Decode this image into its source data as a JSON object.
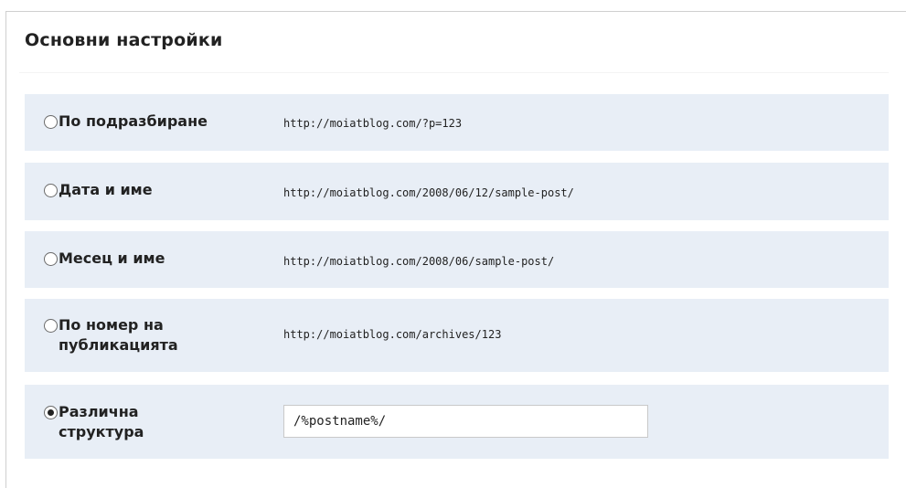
{
  "section": {
    "title": "Основни настройки"
  },
  "options": [
    {
      "label": "По подразбиране",
      "example": "http://moiatblog.com/?p=123",
      "selected": false
    },
    {
      "label": "Дата и име",
      "example": "http://moiatblog.com/2008/06/12/sample-post/",
      "selected": false
    },
    {
      "label": "Месец и име",
      "example": "http://moiatblog.com/2008/06/sample-post/",
      "selected": false
    },
    {
      "label": "По номер на публикацията",
      "example": "http://moiatblog.com/archives/123",
      "selected": false
    },
    {
      "label": "Различна структура",
      "value": "/%postname%/",
      "selected": true
    }
  ],
  "colors": {
    "row_background": "#e8eef6",
    "text": "#222222"
  },
  "icons": {
    "radio_unchecked": "radio-unchecked-icon",
    "radio_checked": "radio-checked-icon"
  }
}
